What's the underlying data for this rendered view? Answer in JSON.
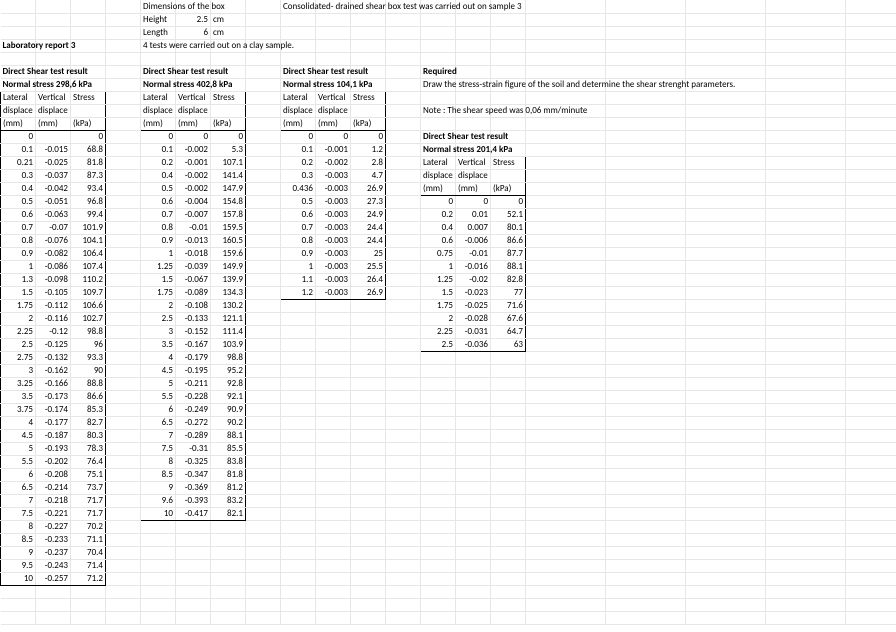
{
  "top": {
    "dim_title": "Dimensions of the box",
    "height_label": "Height",
    "height_val": "2.5",
    "height_unit": "cm",
    "length_label": "Length",
    "length_val": "6",
    "length_unit": "cm",
    "note_consol": "Consolidated- drained shear box test was carried out on sample 3",
    "lab_title": "Laboratory report 3",
    "tests_note": "4 tests were carried out on a clay sample."
  },
  "headers": {
    "dsr": "Direct Shear test result",
    "ns_298": "Normal stress 298,6 kPa",
    "ns_402": "Normal stress 402,8 kPa",
    "ns_104": "Normal stress 104,1 kPa",
    "ns_201": "Normal stress 201,4 kPa",
    "lateral": "Lateral",
    "vertical": "Vertical",
    "stress": "Stress",
    "displace": "displace",
    "mm": "(mm)",
    "kpa": "(kPa)"
  },
  "required": {
    "title": "Required",
    "line1": "Draw the stress-strain figure of the soil and determine the shear strenght parameters.",
    "note": "Note : The shear speed was 0,06 mm/minute"
  },
  "t298": [
    [
      "0",
      "",
      "0"
    ],
    [
      "0.1",
      "-0.015",
      "68.8"
    ],
    [
      "0.21",
      "-0.025",
      "81.8"
    ],
    [
      "0.3",
      "-0.037",
      "87.3"
    ],
    [
      "0.4",
      "-0.042",
      "93.4"
    ],
    [
      "0.5",
      "-0.051",
      "96.8"
    ],
    [
      "0.6",
      "-0.063",
      "99.4"
    ],
    [
      "0.7",
      "-0.07",
      "101.9"
    ],
    [
      "0.8",
      "-0.076",
      "104.1"
    ],
    [
      "0.9",
      "-0.082",
      "106.4"
    ],
    [
      "1",
      "-0.086",
      "107.4"
    ],
    [
      "1.3",
      "-0.098",
      "110.2"
    ],
    [
      "1.5",
      "-0.105",
      "109.7"
    ],
    [
      "1.75",
      "-0.112",
      "106.6"
    ],
    [
      "2",
      "-0.116",
      "102.7"
    ],
    [
      "2.25",
      "-0.12",
      "98.8"
    ],
    [
      "2.5",
      "-0.125",
      "96"
    ],
    [
      "2.75",
      "-0.132",
      "93.3"
    ],
    [
      "3",
      "-0.162",
      "90"
    ],
    [
      "3.25",
      "-0.166",
      "88.8"
    ],
    [
      "3.5",
      "-0.173",
      "86.6"
    ],
    [
      "3.75",
      "-0.174",
      "85.3"
    ],
    [
      "4",
      "-0.177",
      "82.7"
    ],
    [
      "4.5",
      "-0.187",
      "80.3"
    ],
    [
      "5",
      "-0.193",
      "78.3"
    ],
    [
      "5.5",
      "-0.202",
      "76.4"
    ],
    [
      "6",
      "-0.208",
      "75.1"
    ],
    [
      "6.5",
      "-0.214",
      "73.7"
    ],
    [
      "7",
      "-0.218",
      "71.7"
    ],
    [
      "7.5",
      "-0.221",
      "71.7"
    ],
    [
      "8",
      "-0.227",
      "70.2"
    ],
    [
      "8.5",
      "-0.233",
      "71.1"
    ],
    [
      "9",
      "-0.237",
      "70.4"
    ],
    [
      "9.5",
      "-0.243",
      "71.4"
    ],
    [
      "10",
      "-0.257",
      "71.2"
    ]
  ],
  "t402": [
    [
      "0",
      "0",
      "0"
    ],
    [
      "0.1",
      "-0.002",
      "5.3"
    ],
    [
      "0.2",
      "-0.001",
      "107.1"
    ],
    [
      "0.4",
      "-0.002",
      "141.4"
    ],
    [
      "0.5",
      "-0.002",
      "147.9"
    ],
    [
      "0.6",
      "-0.004",
      "154.8"
    ],
    [
      "0.7",
      "-0.007",
      "157.8"
    ],
    [
      "0.8",
      "-0.01",
      "159.5"
    ],
    [
      "0.9",
      "-0.013",
      "160.5"
    ],
    [
      "1",
      "-0.018",
      "159.6"
    ],
    [
      "1.25",
      "-0.039",
      "149.9"
    ],
    [
      "1.5",
      "-0.067",
      "139.9"
    ],
    [
      "1.75",
      "-0.089",
      "134.3"
    ],
    [
      "2",
      "-0.108",
      "130.2"
    ],
    [
      "2.5",
      "-0.133",
      "121.1"
    ],
    [
      "3",
      "-0.152",
      "111.4"
    ],
    [
      "3.5",
      "-0.167",
      "103.9"
    ],
    [
      "4",
      "-0.179",
      "98.8"
    ],
    [
      "4.5",
      "-0.195",
      "95.2"
    ],
    [
      "5",
      "-0.211",
      "92.8"
    ],
    [
      "5.5",
      "-0.228",
      "92.1"
    ],
    [
      "6",
      "-0.249",
      "90.9"
    ],
    [
      "6.5",
      "-0.272",
      "90.2"
    ],
    [
      "7",
      "-0.289",
      "88.1"
    ],
    [
      "7.5",
      "-0.31",
      "85.5"
    ],
    [
      "8",
      "-0.325",
      "83.8"
    ],
    [
      "8.5",
      "-0.347",
      "81.8"
    ],
    [
      "9",
      "-0.369",
      "81.2"
    ],
    [
      "9.6",
      "-0.393",
      "83.2"
    ],
    [
      "10",
      "-0.417",
      "82.1"
    ]
  ],
  "t104": [
    [
      "0",
      "0",
      "0"
    ],
    [
      "0.1",
      "-0.001",
      "1.2"
    ],
    [
      "0.2",
      "-0.002",
      "2.8"
    ],
    [
      "0.3",
      "-0.003",
      "4.7"
    ],
    [
      "0.436",
      "-0.003",
      "26.9"
    ],
    [
      "0.5",
      "-0.003",
      "27.3"
    ],
    [
      "0.6",
      "-0.003",
      "24.9"
    ],
    [
      "0.7",
      "-0.003",
      "24.4"
    ],
    [
      "0.8",
      "-0.003",
      "24.4"
    ],
    [
      "0.9",
      "-0.003",
      "25"
    ],
    [
      "1",
      "-0.003",
      "25.5"
    ],
    [
      "1.1",
      "-0.003",
      "26.4"
    ],
    [
      "1.2",
      "-0.003",
      "26.9"
    ]
  ],
  "t201": [
    [
      "0",
      "0",
      "0"
    ],
    [
      "0.2",
      "0.01",
      "52.1"
    ],
    [
      "0.4",
      "0.007",
      "80.1"
    ],
    [
      "0.6",
      "-0.006",
      "86.6"
    ],
    [
      "0.75",
      "-0.01",
      "87.7"
    ],
    [
      "1",
      "-0.016",
      "88.1"
    ],
    [
      "1.25",
      "-0.02",
      "82.8"
    ],
    [
      "1.5",
      "-0.023",
      "77"
    ],
    [
      "1.75",
      "-0.025",
      "71.6"
    ],
    [
      "2",
      "-0.028",
      "67.6"
    ],
    [
      "2.25",
      "-0.031",
      "64.7"
    ],
    [
      "2.5",
      "-0.036",
      "63"
    ]
  ]
}
